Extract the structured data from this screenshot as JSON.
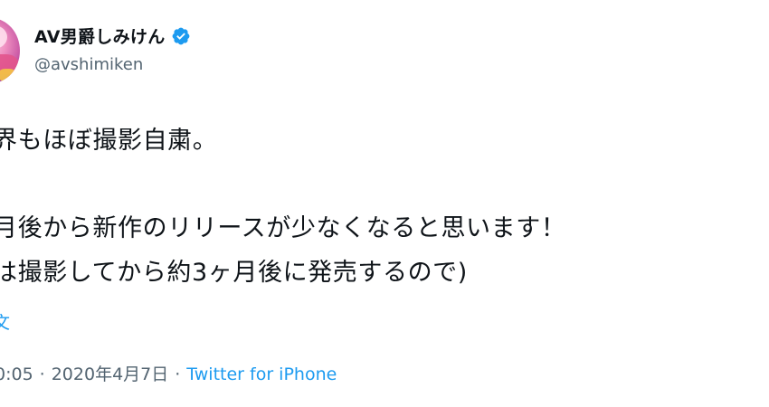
{
  "tweet": {
    "author": {
      "display_name": "AV男爵しみけん",
      "handle": "@avshimiken",
      "verified_icon": "verified-badge-icon",
      "verified_color": "#1d9bf0"
    },
    "lines": [
      "界もほぼ撮影自粛。",
      "月後から新作のリリースが少なくなると思います！",
      "は撮影してから約3ヶ月後に発売するので)"
    ],
    "translate_label": "文",
    "time": "0:05",
    "separator": "·",
    "date": "2020年4月7日",
    "source": "Twitter for iPhone",
    "link_color": "#1d9bf0",
    "muted_color": "#536471"
  }
}
